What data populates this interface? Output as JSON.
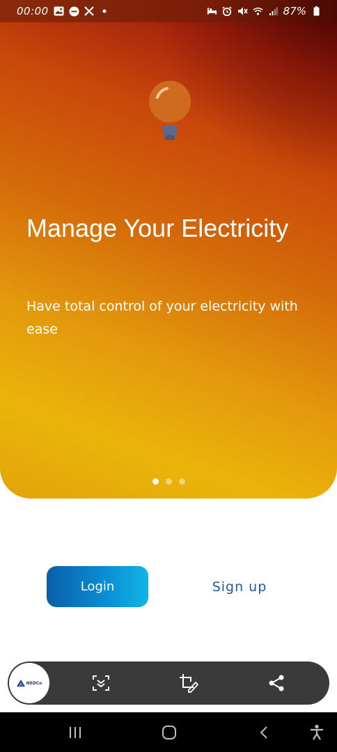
{
  "status_bar": {
    "time": "00:00",
    "battery": "87%",
    "left_icons": [
      "gallery-icon",
      "do-not-disturb-icon",
      "x-logo-icon",
      "notification-dot-icon"
    ],
    "right_icons": [
      "bed-icon",
      "alarm-icon",
      "mute-icon",
      "wifi-icon",
      "signal-icon",
      "battery-icon"
    ]
  },
  "hero": {
    "title": "Manage Your Electricity",
    "subtitle": "Have total control of your electricity with ease",
    "icon": "lightbulb-icon",
    "pagination": {
      "total": 3,
      "active": 1
    }
  },
  "actions": {
    "login_label": "Login",
    "signup_label": "Sign up"
  },
  "capture_toolbar": {
    "thumbnail_text": "NEDCo",
    "tools": [
      "scroll-capture-icon",
      "crop-edit-icon",
      "share-icon"
    ]
  },
  "nav_bar": {
    "buttons": [
      "recent-apps-icon",
      "home-icon",
      "back-icon",
      "accessibility-icon"
    ]
  },
  "colors": {
    "login_gradient_start": "#0a5fa8",
    "login_gradient_end": "#12b4e6",
    "signup_text": "#1a5d94",
    "hero_dark": "#5a0808",
    "hero_orange": "#d46a0a",
    "hero_yellow": "#ebb40a"
  }
}
